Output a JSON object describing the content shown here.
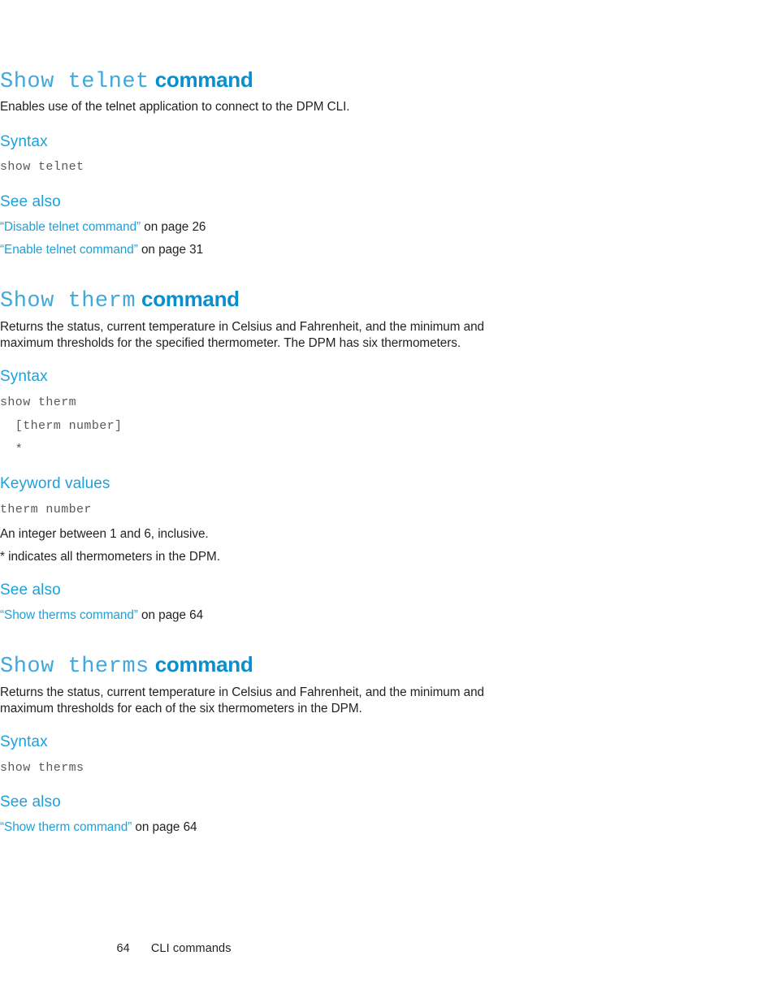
{
  "page": {
    "footer_page_number": "64",
    "footer_label": "CLI commands",
    "accent_blue": "#1ea0da",
    "heading_mono_blue": "#3fa9dd",
    "heading_bold_blue": "#0a8ecd",
    "body_black": "#231f20",
    "code_gray": "#59595b"
  },
  "sections": [
    {
      "heading_mono": "Show telnet",
      "heading_word": "command",
      "description": "Enables use of the telnet application to connect to the DPM CLI.",
      "syntax_label": "Syntax",
      "syntax_lines": [
        "show telnet"
      ],
      "see_also_label": "See also",
      "see_also": [
        {
          "open_quote": "“",
          "link": "Disable telnet command",
          "close_quote": "”",
          "tail": " on page 26"
        },
        {
          "open_quote": "“",
          "link": "Enable telnet command",
          "close_quote": "”",
          "tail": " on page 31"
        }
      ]
    },
    {
      "heading_mono": "Show therm",
      "heading_word": "command",
      "description": "Returns the status, current temperature in Celsius and Fahrenheit, and the minimum and maximum thresholds for the specified thermometer. The DPM has six thermometers.",
      "syntax_label": "Syntax",
      "syntax_lines": [
        "show therm",
        "  [therm number]",
        "  *"
      ],
      "keyword_values_label": "Keyword values",
      "keyword_code": "therm number",
      "keyword_notes": [
        "An integer between 1 and 6, inclusive.",
        "* indicates all thermometers in the DPM."
      ],
      "see_also_label": "See also",
      "see_also": [
        {
          "open_quote": "“",
          "link": "Show therms command",
          "close_quote": "”",
          "tail": " on page 64"
        }
      ]
    },
    {
      "heading_mono": "Show therms",
      "heading_word": "command",
      "description": "Returns the status, current temperature in Celsius and Fahrenheit, and the minimum and maximum thresholds for each of the six thermometers in the DPM.",
      "syntax_label": "Syntax",
      "syntax_lines": [
        "show therms"
      ],
      "see_also_label": "See also",
      "see_also": [
        {
          "open_quote": "“",
          "link": "Show therm command",
          "close_quote": "”",
          "tail": " on page 64"
        }
      ]
    }
  ]
}
